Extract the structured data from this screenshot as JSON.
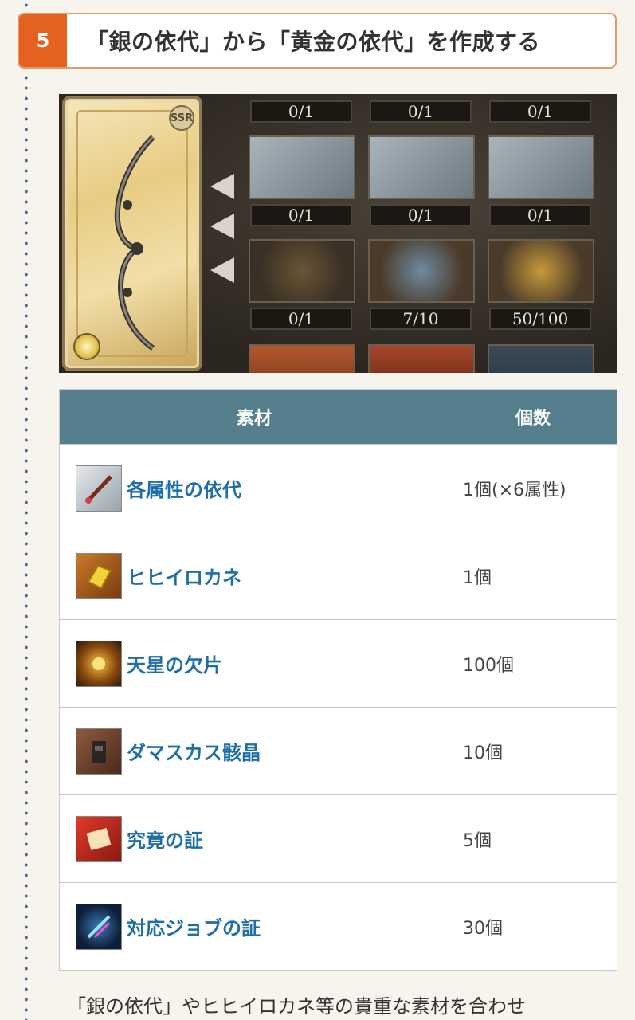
{
  "step": {
    "number": "5",
    "title": "「銀の依代」から「黄金の依代」を作成する"
  },
  "screenshot": {
    "ssr_badge": "SSR",
    "counters_row1": [
      "0/1",
      "0/1",
      "0/1"
    ],
    "counters_row2": [
      "0/1",
      "0/1",
      "0/1"
    ],
    "counters_row3": [
      "0/1",
      "7/10",
      "50/100"
    ]
  },
  "table": {
    "headers": {
      "material": "素材",
      "count": "個数"
    },
    "rows": [
      {
        "name": "各属性の依代",
        "count": "1個(×6属性)",
        "icon": "silver-weapon-icon"
      },
      {
        "name": "ヒヒイロカネ",
        "count": "1個",
        "icon": "gold-ingot-icon"
      },
      {
        "name": "天星の欠片",
        "count": "100個",
        "icon": "star-fragment-icon"
      },
      {
        "name": "ダマスカス骸晶",
        "count": "10個",
        "icon": "damascus-crystal-icon"
      },
      {
        "name": "究竟の証",
        "count": "5個",
        "icon": "proof-scroll-icon"
      },
      {
        "name": "対応ジョブの証",
        "count": "30個",
        "icon": "job-proof-icon"
      }
    ]
  },
  "footer": {
    "text": "「銀の依代」やヒヒイロカネ等の貴重な素材を合わせ"
  }
}
